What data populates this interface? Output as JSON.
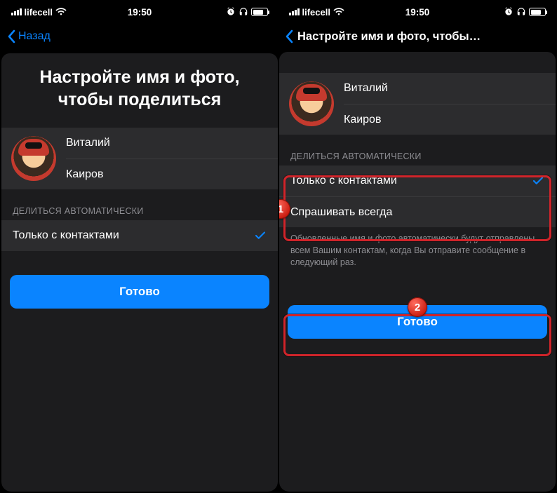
{
  "status": {
    "carrier": "lifecell",
    "time": "19:50",
    "wifi": true,
    "alarm": true,
    "headphones": true
  },
  "left": {
    "back_label": "Назад",
    "title": "Настройте имя и фото, чтобы поделиться",
    "first_name": "Виталий",
    "last_name": "Каиров",
    "auto_header": "ДЕЛИТЬСЯ АВТОМАТИЧЕСКИ",
    "options": [
      {
        "label": "Только с контактами",
        "checked": true
      }
    ],
    "done": "Готово"
  },
  "right": {
    "title_inline": "Настройте имя и фото, чтобы…",
    "first_name": "Виталий",
    "last_name": "Каиров",
    "auto_header": "ДЕЛИТЬСЯ АВТОМАТИЧЕСКИ",
    "options": [
      {
        "label": "Только с контактами",
        "checked": true
      },
      {
        "label": "Спрашивать всегда",
        "checked": false
      }
    ],
    "footer": "Обновленные имя и фото автоматически будут отправлены всем Вашим контактам, когда Вы отправите сообщение в следующий раз.",
    "done": "Готово"
  },
  "badges": {
    "one": "1",
    "two": "2"
  }
}
